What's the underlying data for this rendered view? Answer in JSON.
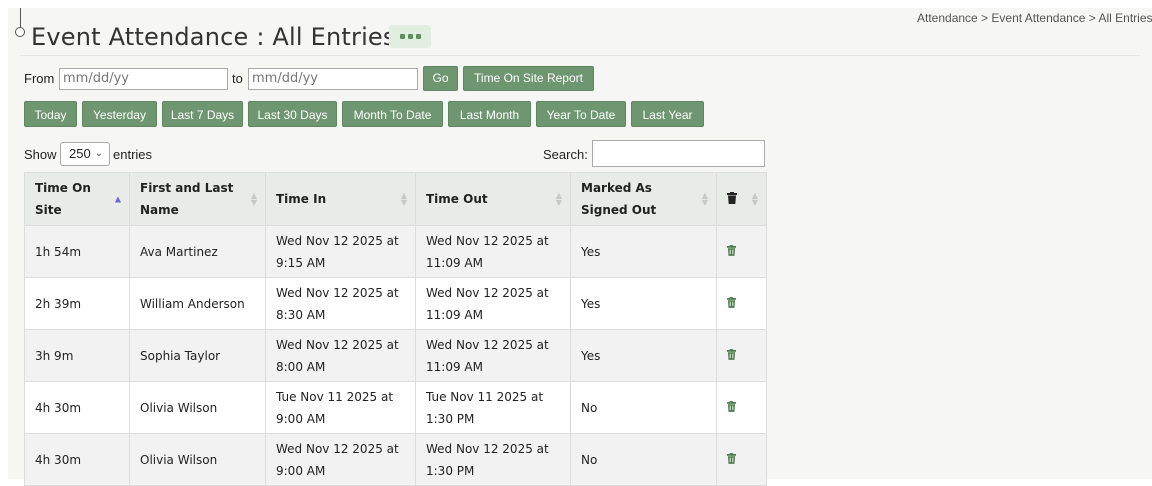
{
  "page": {
    "title": "Event Attendance : All Entries",
    "breadcrumb": "Attendance > Event Attendance > All Entries"
  },
  "filters": {
    "from_label": "From",
    "to_label": "to",
    "from_placeholder": "mm/dd/yy",
    "to_placeholder": "mm/dd/yy",
    "go_label": "Go",
    "report_label": "Time On Site Report"
  },
  "quick_ranges": [
    "Today",
    "Yesterday",
    "Last 7 Days",
    "Last 30 Days",
    "Month To Date",
    "Last Month",
    "Year To Date",
    "Last Year"
  ],
  "length": {
    "show_label": "Show",
    "value": "250",
    "entries_label": "entries"
  },
  "search": {
    "label": "Search:",
    "value": ""
  },
  "table": {
    "columns": [
      "Time On Site",
      "First and Last Name",
      "Time In",
      "Time Out",
      "Marked As Signed Out",
      ""
    ],
    "sorted_column": "Time On Site",
    "sort_direction": "ascending",
    "rows": [
      {
        "time_on_site": "1h 54m",
        "name": "Ava Martinez",
        "time_in": "Wed Nov 12 2025 at 9:15 AM",
        "time_out": "Wed Nov 12 2025 at 11:09 AM",
        "signed_out": "Yes"
      },
      {
        "time_on_site": "2h 39m",
        "name": "William Anderson",
        "time_in": "Wed Nov 12 2025 at 8:30 AM",
        "time_out": "Wed Nov 12 2025 at 11:09 AM",
        "signed_out": "Yes"
      },
      {
        "time_on_site": "3h 9m",
        "name": "Sophia Taylor",
        "time_in": "Wed Nov 12 2025 at 8:00 AM",
        "time_out": "Wed Nov 12 2025 at 11:09 AM",
        "signed_out": "Yes"
      },
      {
        "time_on_site": "4h 30m",
        "name": "Olivia Wilson",
        "time_in": "Tue Nov 11 2025 at 9:00 AM",
        "time_out": "Tue Nov 11 2025 at 1:30 PM",
        "signed_out": "No"
      },
      {
        "time_on_site": "4h 30m",
        "name": "Olivia Wilson",
        "time_in": "Wed Nov 12 2025 at 9:00 AM",
        "time_out": "Wed Nov 12 2025 at 1:30 PM",
        "signed_out": "No"
      }
    ]
  },
  "icons": {
    "more": "ellipsis-icon",
    "delete": "trash-icon",
    "select_arrow": "chevron-down-icon"
  },
  "colors": {
    "button_green": "#6e9670",
    "sort_active": "#6a6ad8",
    "trash_green": "#4d7d4d"
  }
}
